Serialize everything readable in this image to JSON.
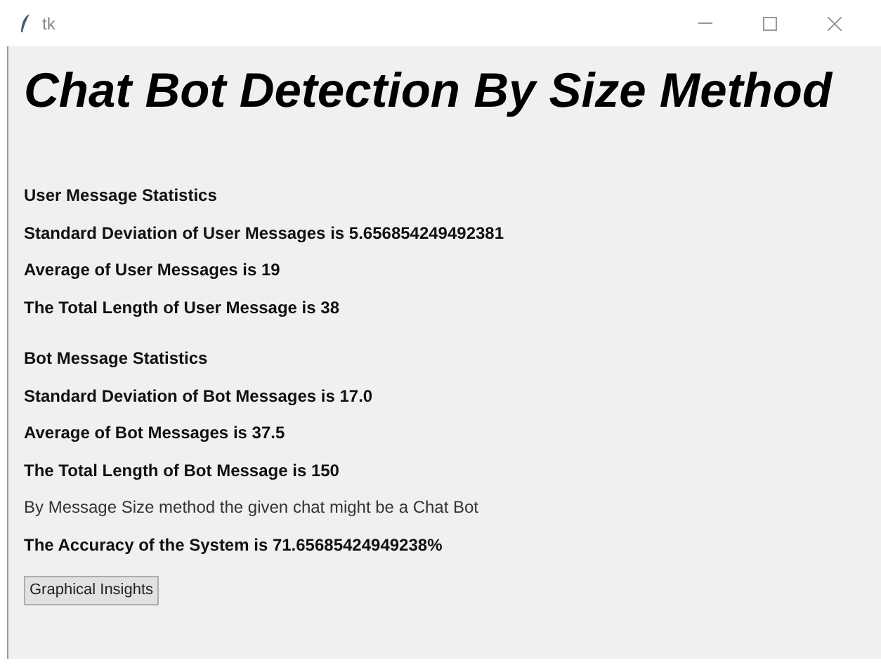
{
  "window": {
    "title": "tk"
  },
  "heading": "Chat Bot Detection By Size Method",
  "groups": [
    {
      "lines": [
        {
          "text": "User Message Statistics",
          "bold": true
        },
        {
          "text": "Standard Deviation of User Messages is 5.656854249492381",
          "bold": true
        },
        {
          "text": "Average of User Messages is 19",
          "bold": true
        },
        {
          "text": "The Total Length of User Message is 38",
          "bold": true
        }
      ]
    },
    {
      "lines": [
        {
          "text": "Bot Message Statistics",
          "bold": true
        },
        {
          "text": "Standard Deviation of Bot Messages is 17.0",
          "bold": true
        },
        {
          "text": "Average of Bot Messages is 37.5",
          "bold": true
        },
        {
          "text": "The Total Length of Bot Message is 150",
          "bold": true
        },
        {
          "text": "By Message Size method the given chat might be a Chat Bot",
          "bold": false
        },
        {
          "text": "The Accuracy of the System is 71.65685424949238%",
          "bold": true
        }
      ]
    }
  ],
  "button": "Graphical Insights"
}
